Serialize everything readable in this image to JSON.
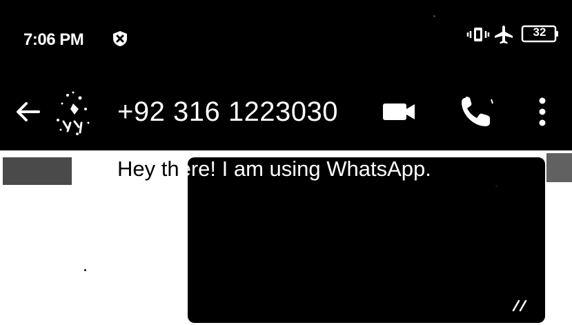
{
  "status_bar": {
    "time": "7:06 PM",
    "battery": "32",
    "icons": [
      "shield-x-icon",
      "vibrate-icon",
      "airplane-icon",
      "battery-icon"
    ]
  },
  "app_bar": {
    "contact_name": "+92 316 1223030",
    "icons": [
      "back-arrow-icon",
      "avatar",
      "video-call-icon",
      "voice-call-icon",
      "more-vert-icon"
    ]
  },
  "chat": {
    "about_prefix": "Hey th",
    "about_suffix": "ere! I am using WhatsApp.",
    "message_status": "read-double-check-icon"
  },
  "colors": {
    "header_bg": "#000000",
    "text_light": "#ffffff",
    "chat_bg": "#ffffff"
  }
}
